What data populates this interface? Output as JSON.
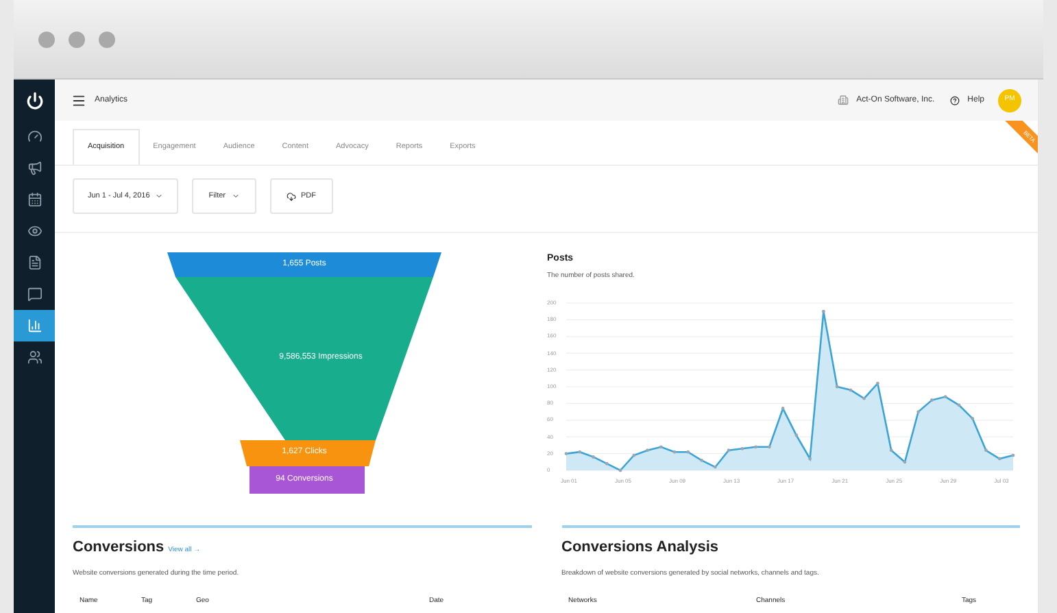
{
  "sidebar": {
    "items": [
      {
        "kind": "gauge",
        "selected": false
      },
      {
        "kind": "megaphone",
        "selected": false
      },
      {
        "kind": "calendar",
        "selected": false
      },
      {
        "kind": "eye",
        "selected": false
      },
      {
        "kind": "page",
        "selected": false
      },
      {
        "kind": "chat",
        "selected": false
      },
      {
        "kind": "chart",
        "selected": true
      },
      {
        "kind": "people",
        "selected": false
      }
    ]
  },
  "header": {
    "title": "Analytics",
    "account": "Act-On Software, Inc.",
    "help": "Help",
    "avatar": "PM",
    "ribbon": "BETA"
  },
  "tabs": [
    {
      "label": "Acquisition",
      "selected": true
    },
    {
      "label": "Engagement",
      "selected": false
    },
    {
      "label": "Audience",
      "selected": false
    },
    {
      "label": "Content",
      "selected": false
    },
    {
      "label": "Advocacy",
      "selected": false
    },
    {
      "label": "Reports",
      "selected": false
    },
    {
      "label": "Exports",
      "selected": false
    }
  ],
  "toolbar": {
    "date_range": "Jun 1 - Jul 4, 2016",
    "filter": "Filter",
    "pdf": "PDF"
  },
  "funnel": {
    "stages": [
      {
        "label": "1,655 Posts",
        "color": "#1e8bd8"
      },
      {
        "label": "9,586,553 Impressions",
        "color": "#17ad8d"
      },
      {
        "label": "1,627 Clicks",
        "color": "#f7930e"
      },
      {
        "label": "94 Conversions",
        "color": "#a855d6"
      }
    ]
  },
  "posts": {
    "title": "Posts",
    "subtitle": "The number of posts shared.",
    "chart_data": {
      "type": "area",
      "grid": true,
      "categories": [
        "Jun 01",
        null,
        null,
        null,
        "Jun 05",
        null,
        null,
        null,
        "Jun 09",
        null,
        null,
        null,
        "Jun 13",
        null,
        null,
        null,
        "Jun 17",
        null,
        null,
        null,
        "Jun 21",
        null,
        null,
        null,
        "Jun 25",
        null,
        null,
        null,
        "Jun 29",
        null,
        null,
        null,
        "Jul 03",
        null
      ],
      "series": [
        {
          "color": "#3ba3d6",
          "values": [
            20,
            22,
            16,
            8,
            0,
            18,
            24,
            28,
            22,
            22,
            12,
            4,
            24,
            26,
            28,
            28,
            74,
            42,
            14,
            190,
            100,
            96,
            86,
            104,
            24,
            10,
            70,
            84,
            88,
            78,
            62,
            24,
            14,
            18
          ]
        }
      ],
      "ylim": [
        0,
        200
      ],
      "yticks": [
        0,
        20,
        40,
        60,
        80,
        100,
        120,
        140,
        160,
        180,
        200
      ]
    }
  },
  "conversions": {
    "title": "Conversions",
    "link": "View all →",
    "subtitle": "Website conversions generated during the time period.",
    "columns": [
      "Name",
      "Tag",
      "Geo",
      "Date"
    ]
  },
  "analysis": {
    "title": "Conversions Analysis",
    "subtitle": "Breakdown of website conversions generated by social networks, channels and tags.",
    "columns": [
      "Networks",
      "Channels",
      "Tags"
    ]
  }
}
